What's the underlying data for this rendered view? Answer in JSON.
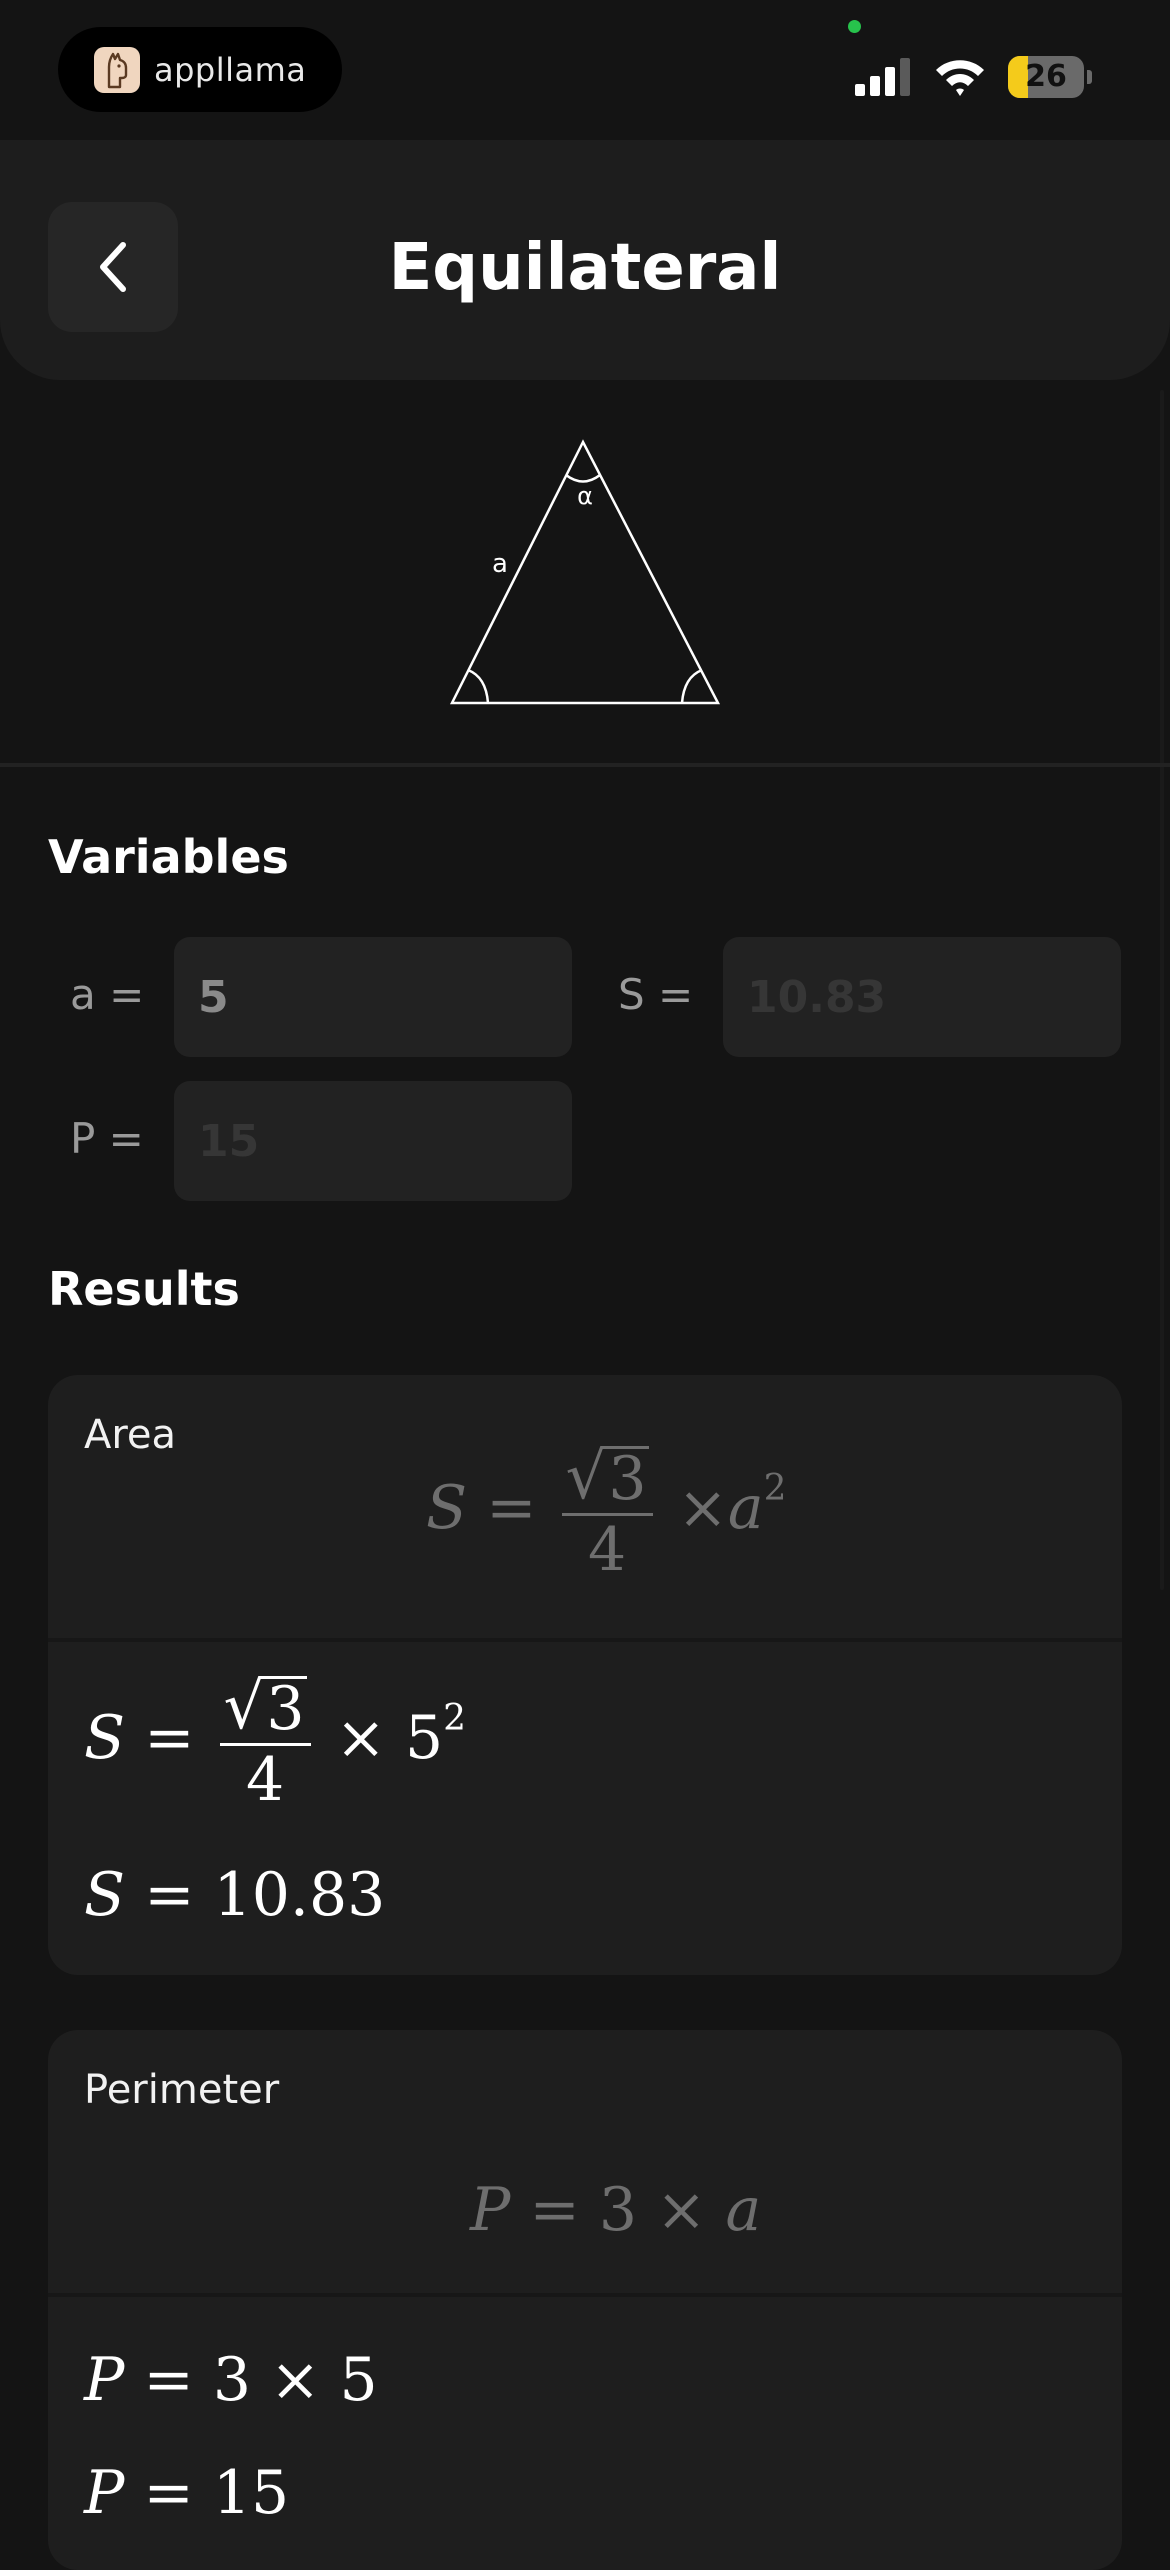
{
  "status_bar": {
    "brand": "appllama",
    "battery": "26",
    "battery_level_percent": 26,
    "icons": [
      "cellular-signal-icon",
      "wifi-icon",
      "battery-icon"
    ]
  },
  "header": {
    "title": "Equilateral",
    "back_icon": "chevron-left-icon"
  },
  "diagram": {
    "side_label": "a",
    "angle_label": "α"
  },
  "variables": {
    "title": "Variables",
    "fields": [
      {
        "label": "a =",
        "value": "5"
      },
      {
        "label": "S =",
        "value": "10.83"
      },
      {
        "label": "P =",
        "value": "15"
      }
    ]
  },
  "results": {
    "title": "Results",
    "area": {
      "label": "Area",
      "general": {
        "lhs": "S",
        "eq": "=",
        "num": "3",
        "den": "4",
        "times": "×",
        "var": "a",
        "exp": "2"
      },
      "substituted": {
        "lhs": "S",
        "eq": "=",
        "num": "3",
        "den": "4",
        "times": "×",
        "val": "5",
        "exp": "2"
      },
      "result": {
        "lhs": "S",
        "eq": "=",
        "val": "10.83"
      }
    },
    "perimeter": {
      "label": "Perimeter",
      "general": {
        "lhs": "P",
        "eq": "=",
        "coef": "3",
        "times": "×",
        "var": "a"
      },
      "substituted": {
        "lhs": "P",
        "eq": "=",
        "coef": "3",
        "times": "×",
        "val": "5"
      },
      "result": {
        "lhs": "P",
        "eq": "=",
        "val": "15"
      }
    }
  },
  "colors": {
    "background": "#141414",
    "header": "#1d1d1d",
    "card": "#1e1e1e",
    "input": "#222222",
    "battery_fill": "#f4cb1b",
    "camera_dot": "#27c24c"
  }
}
